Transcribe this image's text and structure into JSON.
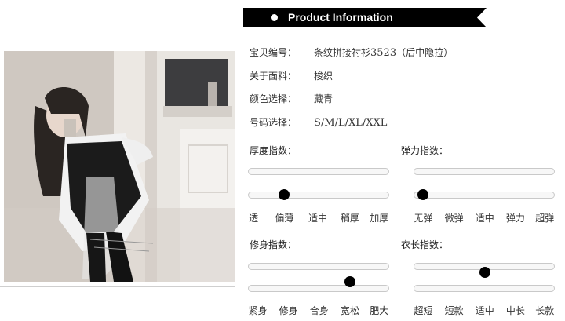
{
  "banner": {
    "title": "Product Information"
  },
  "info": [
    {
      "label": "宝贝编号：",
      "value_pre": "条纹拼接衬衫",
      "value_num": "3523",
      "value_post": "（后中隐拉）"
    },
    {
      "label": "关于面料：",
      "value": "梭织"
    },
    {
      "label": "颜色选择：",
      "value": "藏青"
    },
    {
      "label": "号码选择：",
      "value": "S/M/L/XL/XXL"
    }
  ],
  "sliders": {
    "thickness": {
      "title": "厚度指数：",
      "ticks": [
        "透",
        "偏薄",
        "适中",
        "稍厚",
        "加厚"
      ],
      "selected_index": 1
    },
    "elasticity": {
      "title": "弹力指数：",
      "ticks": [
        "无弹",
        "微弹",
        "适中",
        "弹力",
        "超弹"
      ],
      "selected_index": 0
    },
    "fit": {
      "title": "修身指数：",
      "ticks": [
        "紧身",
        "修身",
        "合身",
        "宽松",
        "肥大"
      ],
      "selected_index": 3
    },
    "length": {
      "title": "衣长指数：",
      "ticks": [
        "超短",
        "短款",
        "适中",
        "中长",
        "长款"
      ],
      "selected_index": 2
    }
  },
  "colors": {
    "banner_bg": "#000000",
    "knob": "#000000",
    "track_border": "#c9c9c9"
  }
}
